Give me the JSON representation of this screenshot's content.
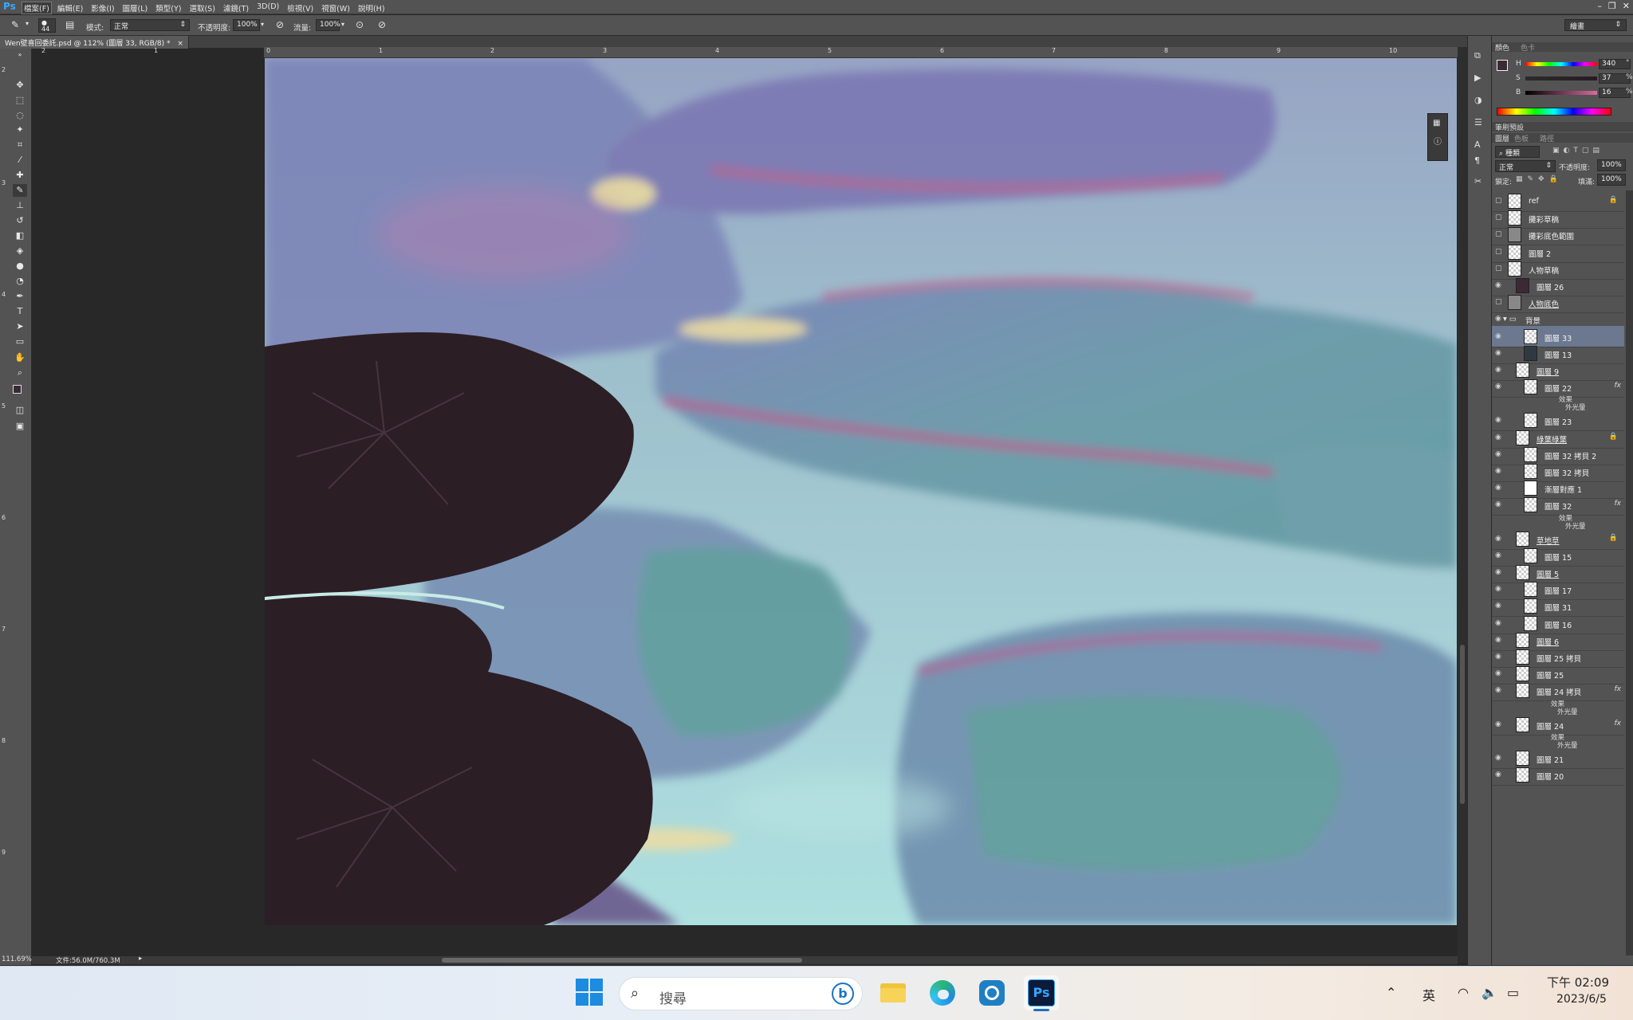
{
  "app": {
    "logo": "Ps"
  },
  "menubar": {
    "items": [
      "檔案(F)",
      "編輯(E)",
      "影像(I)",
      "圖層(L)",
      "類型(Y)",
      "選取(S)",
      "濾鏡(T)",
      "3D(D)",
      "檢視(V)",
      "視窗(W)",
      "說明(H)"
    ],
    "window_controls": [
      "–",
      "❐",
      "✕"
    ]
  },
  "options": {
    "brush_size": "44",
    "mode_label": "模式:",
    "mode_value": "正常",
    "opacity_label": "不透明度:",
    "opacity_value": "100%",
    "flow_label": "流量:",
    "flow_value": "100%",
    "workspace": "繪畫"
  },
  "document": {
    "tab_title": "Wen壁喜回委託.psd @ 112% (圖層 33, RGB/8) *",
    "close": "×"
  },
  "ruler": {
    "h_ticks": [
      "2",
      "1",
      "0",
      "1",
      "2",
      "3",
      "4",
      "5",
      "6",
      "7",
      "8",
      "9",
      "10"
    ],
    "v_ticks": [
      "2",
      "3",
      "4",
      "5",
      "6",
      "7",
      "8",
      "9"
    ]
  },
  "status": {
    "zoom": "111.69%",
    "doc_size": "文件:56.0M/760.3M"
  },
  "color_panel": {
    "tabs": [
      "顏色",
      "色卡"
    ],
    "h_label": "H",
    "h_value": "340",
    "h_unit": "°",
    "s_label": "S",
    "s_value": "37",
    "s_unit": "%",
    "b_label": "B",
    "b_value": "16",
    "b_unit": "%",
    "foreground": "#3b2a33",
    "background": "#ffffff"
  },
  "brush_preset_panel": {
    "title": "筆刷預設"
  },
  "layers_panel": {
    "tabs": [
      "圖層",
      "色板",
      "路徑"
    ],
    "filter_kind": "種類",
    "blend_mode": "正常",
    "opacity_label": "不透明度:",
    "opacity_value": "100%",
    "lock_label": "鎖定:",
    "fill_label": "填滿:",
    "fill_value": "100%",
    "layers": [
      {
        "name": "ref",
        "thumb": "checker",
        "indent": 0,
        "lock": true,
        "eye": false
      },
      {
        "name": "攤彩草稿",
        "thumb": "checker",
        "indent": 0,
        "eye": false
      },
      {
        "name": "攤彩底色範圍",
        "thumb": "gray",
        "indent": 0,
        "eye": false
      },
      {
        "name": "圖層 2",
        "thumb": "checker",
        "indent": 0,
        "eye": false
      },
      {
        "name": "人物草稿",
        "thumb": "checker",
        "indent": 0,
        "eye": false
      },
      {
        "name": "圖層 26",
        "thumb": "dark",
        "indent": 1,
        "eye": true
      },
      {
        "name": "人物底色",
        "thumb": "gray",
        "indent": 0,
        "eye": false,
        "underline": true
      },
      {
        "name": "背景",
        "thumb": "folder",
        "indent": 0,
        "eye": true,
        "group": true
      },
      {
        "name": "圖層 33",
        "thumb": "checker",
        "indent": 2,
        "eye": true,
        "selected": true
      },
      {
        "name": "圖層 13",
        "thumb": "mono",
        "indent": 2,
        "eye": true
      },
      {
        "name": "圖層 9",
        "thumb": "checker",
        "indent": 1,
        "eye": true,
        "underline": true
      },
      {
        "name": "圖層 22",
        "thumb": "checker",
        "indent": 2,
        "eye": true,
        "fx": true
      },
      {
        "name": "圖層 23",
        "thumb": "checker",
        "indent": 2,
        "eye": true
      },
      {
        "name": "綠葉綠葉",
        "thumb": "checker",
        "indent": 1,
        "eye": true,
        "underline": true,
        "lock": true
      },
      {
        "name": "圖層 32 拷貝 2",
        "thumb": "checker",
        "indent": 2,
        "eye": true
      },
      {
        "name": "圖層 32 拷貝",
        "thumb": "checker",
        "indent": 2,
        "eye": true
      },
      {
        "name": "漸層對應 1",
        "thumb": "white",
        "indent": 2,
        "eye": true
      },
      {
        "name": "圖層 32",
        "thumb": "checker",
        "indent": 2,
        "eye": true,
        "fx": true
      },
      {
        "name": "草地草",
        "thumb": "checker",
        "indent": 1,
        "eye": true,
        "underline": true,
        "lock": true
      },
      {
        "name": "圖層 15",
        "thumb": "checker",
        "indent": 2,
        "eye": true
      },
      {
        "name": "圖層 5",
        "thumb": "checker",
        "indent": 1,
        "eye": true,
        "underline": true
      },
      {
        "name": "圖層 17",
        "thumb": "checker",
        "indent": 2,
        "eye": true
      },
      {
        "name": "圖層 31",
        "thumb": "checker",
        "indent": 2,
        "eye": true
      },
      {
        "name": "圖層 16",
        "thumb": "checker",
        "indent": 2,
        "eye": true
      },
      {
        "name": "圖層 6",
        "thumb": "checker",
        "indent": 1,
        "eye": true,
        "underline": true
      },
      {
        "name": "圖層 25 拷貝",
        "thumb": "checker",
        "indent": 1,
        "eye": true
      },
      {
        "name": "圖層 25",
        "thumb": "checker",
        "indent": 1,
        "eye": true
      },
      {
        "name": "圖層 24 拷貝",
        "thumb": "checker",
        "indent": 1,
        "eye": true,
        "fx": true
      },
      {
        "name": "圖層 24",
        "thumb": "checker",
        "indent": 1,
        "eye": true,
        "fx": true
      },
      {
        "name": "圖層 21",
        "thumb": "checker",
        "indent": 1,
        "eye": true
      },
      {
        "name": "圖層 20",
        "thumb": "checker",
        "indent": 1,
        "eye": true
      }
    ],
    "effects_label": "效果",
    "outer_glow_label": "外光暈"
  },
  "taskbar": {
    "search_placeholder": "搜尋",
    "time": "下午 02:09",
    "date": "2023/6/5"
  }
}
